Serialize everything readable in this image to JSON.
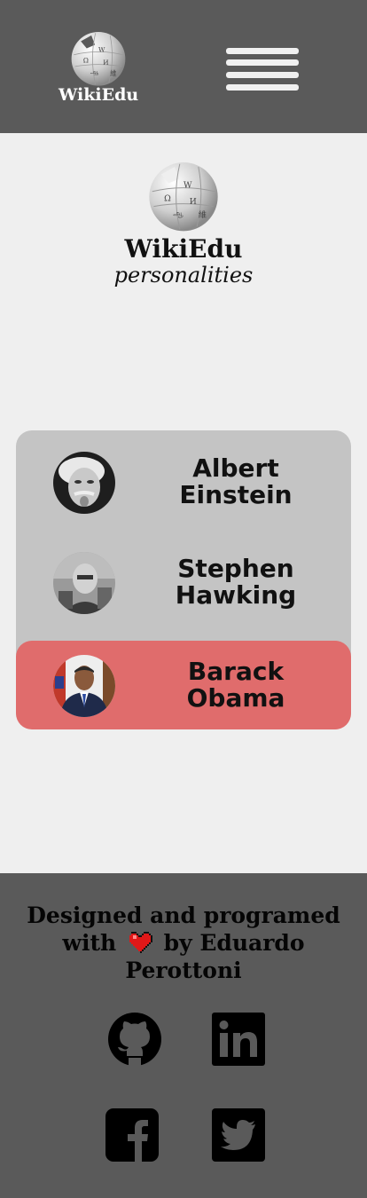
{
  "header": {
    "logo_text": "WikiEdu",
    "menu_icon": "hamburger-menu-icon"
  },
  "hero": {
    "title": "WikiEdu",
    "subtitle": "personalities",
    "logo_icon": "wikipedia-globe-icon"
  },
  "personalities": [
    {
      "name_first": "Albert",
      "name_last": "Einstein",
      "active": false
    },
    {
      "name_first": "Stephen",
      "name_last": "Hawking",
      "active": false
    },
    {
      "name_first": "Barack",
      "name_last": "Obama",
      "active": true
    }
  ],
  "footer": {
    "line1": "Designed and programed",
    "line2_start": "with",
    "line2_end": "by Eduardo",
    "line3": "Perottoni",
    "heart_icon": "heart-icon",
    "social": [
      "github-icon",
      "linkedin-icon",
      "facebook-icon",
      "twitter-icon"
    ]
  },
  "colors": {
    "header_bg": "#5a5a5a",
    "page_bg": "#efefef",
    "card_bg": "#c4c4c4",
    "active_bg": "#e06c6c"
  }
}
